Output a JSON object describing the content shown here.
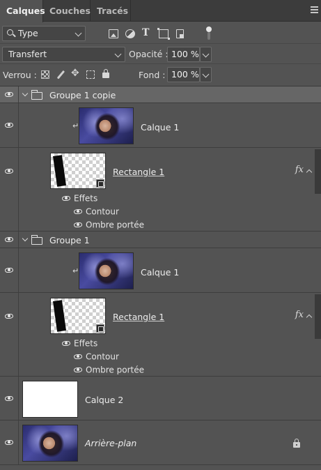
{
  "tabs": [
    "Calques",
    "Couches",
    "Tracés"
  ],
  "filter": {
    "type_label": "Type"
  },
  "blend": {
    "mode": "Transfert",
    "opacity_label": "Opacité :",
    "opacity_value": "100 %"
  },
  "lock": {
    "label": "Verrou :",
    "fill_label": "Fond :",
    "fill_value": "100 %"
  },
  "layers": {
    "group1_copy": "Groupe 1 copie",
    "calque1_a": "Calque 1",
    "rect1_a": "Rectangle 1",
    "effects_a": {
      "title": "Effets",
      "contour": "Contour",
      "shadow": "Ombre portée"
    },
    "group1": "Groupe 1",
    "calque1_b": "Calque 1",
    "rect1_b": "Rectangle 1",
    "effects_b": {
      "title": "Effets",
      "contour": "Contour",
      "shadow": "Ombre portée"
    },
    "calque2": "Calque 2",
    "background": "Arrière-plan",
    "fx_label": "fx",
    "clip_glyph": "↵"
  },
  "icons": {
    "move_glyph": "✥"
  }
}
